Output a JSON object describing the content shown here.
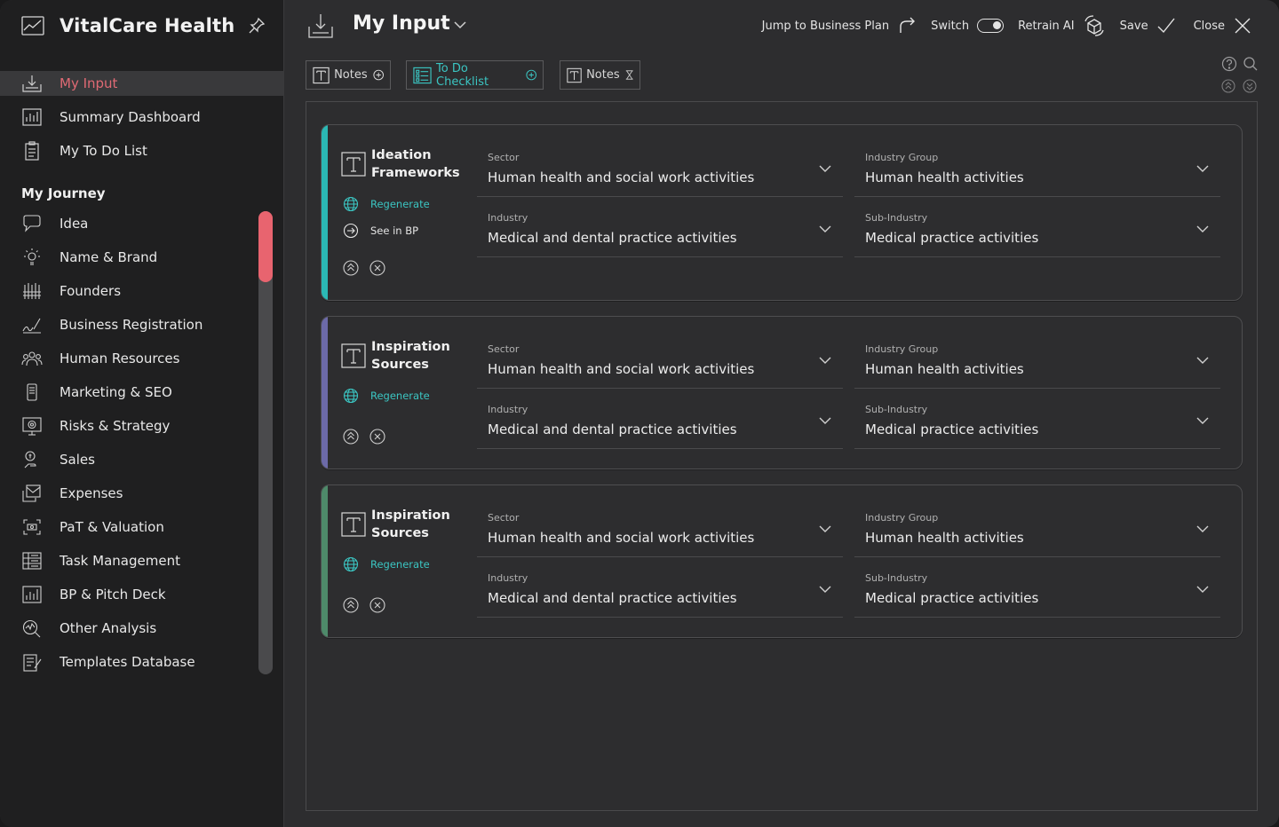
{
  "app": {
    "title": "VitalCare Health"
  },
  "sidebar": {
    "top_items": [
      {
        "label": "My Input",
        "icon": "download-tray-icon",
        "active": true
      },
      {
        "label": "Summary Dashboard",
        "icon": "dashboard-chart-icon"
      },
      {
        "label": "My To Do List",
        "icon": "clipboard-icon"
      }
    ],
    "section_title": "My Journey",
    "journey_items": [
      {
        "label": "Idea",
        "icon": "speech-bubble-icon"
      },
      {
        "label": "Name & Brand",
        "icon": "lightbulb-icon"
      },
      {
        "label": "Founders",
        "icon": "people-group-icon"
      },
      {
        "label": "Business Registration",
        "icon": "signature-icon"
      },
      {
        "label": "Human Resources",
        "icon": "team-icon"
      },
      {
        "label": "Marketing & SEO",
        "icon": "phone-icon"
      },
      {
        "label": "Risks & Strategy",
        "icon": "target-screen-icon"
      },
      {
        "label": "Sales",
        "icon": "coin-hand-icon"
      },
      {
        "label": "Expenses",
        "icon": "receipt-icon"
      },
      {
        "label": "PaT & Valuation",
        "icon": "valuation-frame-icon"
      },
      {
        "label": "Task Management",
        "icon": "task-list-icon"
      },
      {
        "label": "BP & Pitch Deck",
        "icon": "bar-chart-icon"
      },
      {
        "label": "Other Analysis",
        "icon": "magnifier-chart-icon"
      },
      {
        "label": "Templates Database",
        "icon": "template-edit-icon"
      }
    ]
  },
  "header": {
    "title": "My Input",
    "actions": {
      "jump": "Jump to Business Plan",
      "switch": "Switch",
      "retrain": "Retrain AI",
      "save": "Save",
      "close": "Close"
    }
  },
  "tabs": [
    {
      "label": "Notes",
      "icon": "text-box-icon",
      "suffix": "plus-circle-icon"
    },
    {
      "label": "To Do Checklist",
      "icon": "checklist-icon",
      "suffix": "plus-circle-icon"
    },
    {
      "label": "Notes",
      "icon": "text-box-icon",
      "suffix": "hourglass-icon"
    }
  ],
  "cards": [
    {
      "title": "Ideation Frameworks",
      "accent": "#2bb8b4",
      "regenerate": "Regenerate",
      "see_in_bp": "See in BP",
      "fields": [
        {
          "label": "Sector",
          "value": "Human health and social work activities"
        },
        {
          "label": "Industry Group",
          "value": "Human health activities"
        },
        {
          "label": "Industry",
          "value": "Medical and dental practice activities"
        },
        {
          "label": "Sub-Industry",
          "value": "Medical practice activities"
        }
      ]
    },
    {
      "title": "Inspiration Sources",
      "accent": "#6c6aa8",
      "regenerate": "Regenerate",
      "fields": [
        {
          "label": "Sector",
          "value": "Human health and social work activities"
        },
        {
          "label": "Industry Group",
          "value": "Human health activities"
        },
        {
          "label": "Industry",
          "value": "Medical and dental practice activities"
        },
        {
          "label": "Sub-Industry",
          "value": "Medical practice activities"
        }
      ]
    },
    {
      "title": "Inspiration Sources",
      "accent": "#4e8a6a",
      "regenerate": "Regenerate",
      "fields": [
        {
          "label": "Sector",
          "value": "Human health and social work activities"
        },
        {
          "label": "Industry Group",
          "value": "Human health activities"
        },
        {
          "label": "Industry",
          "value": "Medical and dental practice activities"
        },
        {
          "label": "Sub-Industry",
          "value": "Medical practice activities"
        }
      ]
    }
  ],
  "colors": {
    "accent_red": "#e8646f",
    "accent_teal": "#3bc5c2"
  }
}
